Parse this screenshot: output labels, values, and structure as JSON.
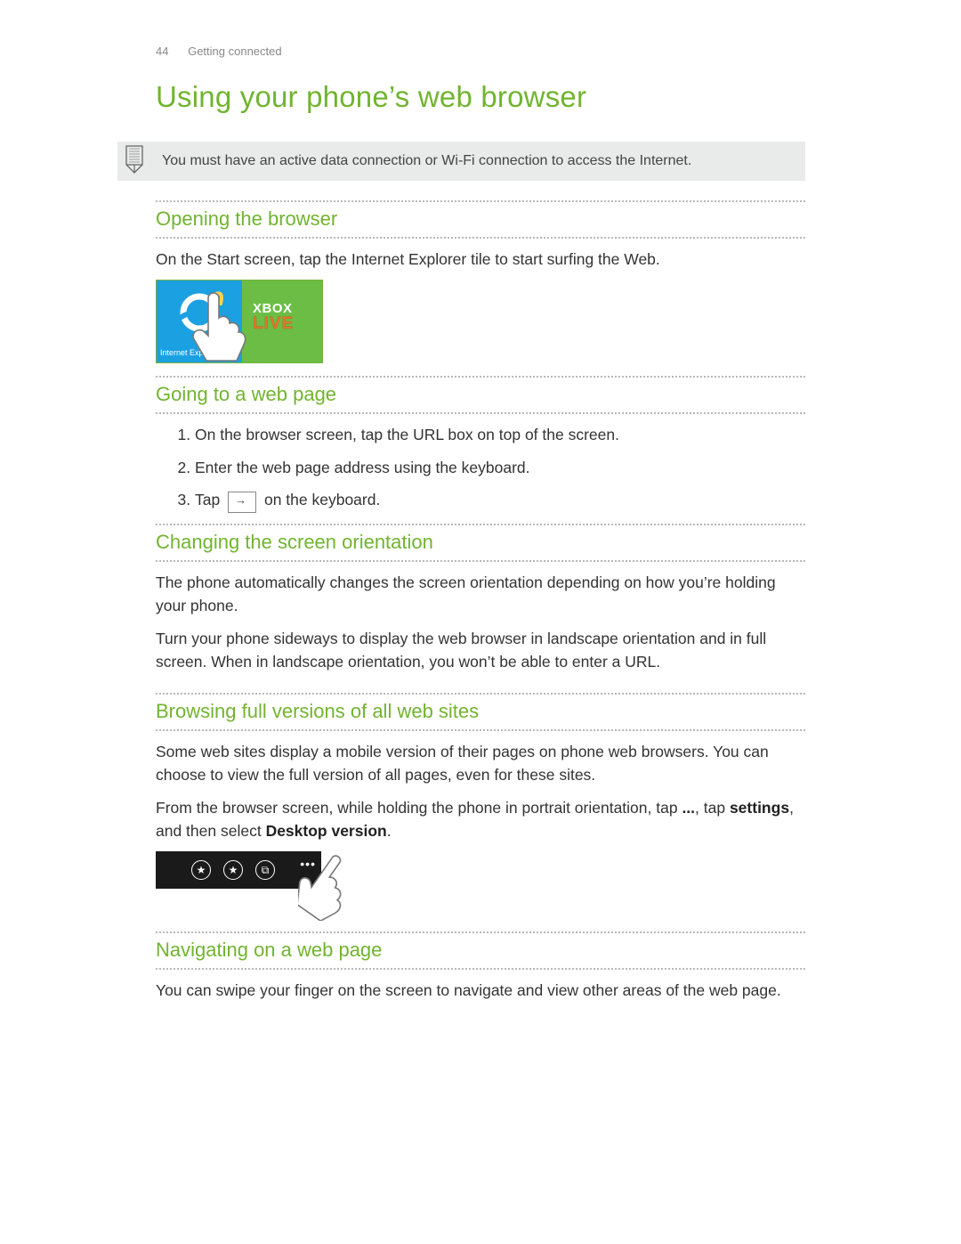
{
  "header": {
    "page_number": "44",
    "chapter": "Getting connected"
  },
  "title": "Using your phone’s web browser",
  "note": "You must have an active data connection or Wi-Fi connection to access the Internet.",
  "s1": {
    "heading": "Opening the browser",
    "p1": "On the Start screen, tap the Internet Explorer tile to start surfing the Web.",
    "tile_ie_label": "Internet Explorer",
    "tile_xbox_top": "XBOX",
    "tile_xbox_bot": "LIVE"
  },
  "s2": {
    "heading": "Going to a web page",
    "step1": "On the browser screen, tap the URL box on top of the screen.",
    "step2": "Enter the web page address using the keyboard.",
    "step3_a": "Tap",
    "step3_b": "on the keyboard."
  },
  "s3": {
    "heading": "Changing the screen orientation",
    "p1": "The phone automatically changes the screen orientation depending on how you’re holding your phone.",
    "p2": "Turn your phone sideways to display the web browser in landscape orientation and in full screen. When in landscape orientation, you won’t be able to enter a URL."
  },
  "s4": {
    "heading": "Browsing full versions of all web sites",
    "p1": "Some web sites display a mobile version of their pages on phone web browsers. You can choose to view the full version of all pages, even for these sites.",
    "p2_a": "From the browser screen, while holding the phone in portrait orientation, tap ",
    "p2_dots": "...",
    "p2_b": ", tap ",
    "p2_settings": "settings",
    "p2_c": ", and then select ",
    "p2_desktop": "Desktop version",
    "p2_d": "."
  },
  "s5": {
    "heading": "Navigating on a web page",
    "p1": "You can swipe your finger on the screen to navigate and view other areas of the web page."
  },
  "appbar": {
    "icon1": "★",
    "icon2": "★",
    "icon3": "⧉",
    "dots": "•••"
  }
}
